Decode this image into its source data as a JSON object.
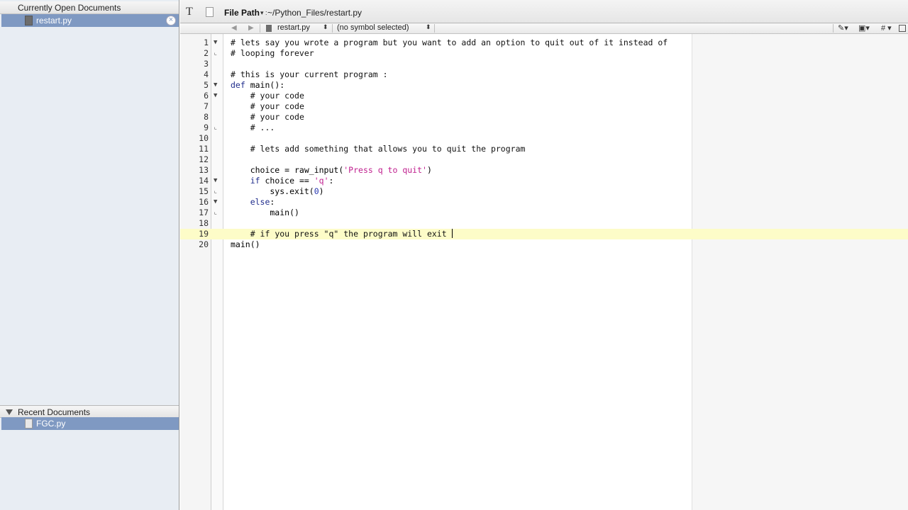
{
  "sidebar": {
    "open_header": "Currently Open Documents",
    "open_documents": [
      {
        "name": "restart.py"
      }
    ],
    "recent_header": "Recent Documents",
    "recent_documents": [
      {
        "name": "FGC.py"
      }
    ],
    "close_glyph": "×"
  },
  "toolbar": {
    "text_icon": "T",
    "path_label": "File Path",
    "path_caret": "▾ :",
    "path_value": "~/Python_Files/restart.py"
  },
  "navbar": {
    "back": "◀",
    "forward": "▶",
    "file": "restart.py",
    "symbol": "(no symbol selected)",
    "stepper": "⬍",
    "pencil": "✎▾",
    "square": "▣▾",
    "hash": "# ▾"
  },
  "editor": {
    "current_line": 19,
    "lines": [
      {
        "n": "1",
        "fold": "▼",
        "code": "# lets say you wrote a program but you want to add an option to quit out of it instead of"
      },
      {
        "n": "2",
        "fold": "⌞",
        "code": "# looping forever"
      },
      {
        "n": "3",
        "fold": "",
        "code": ""
      },
      {
        "n": "4",
        "fold": "",
        "code": "# this is your current program :"
      },
      {
        "n": "5",
        "fold": "▼",
        "code": "def main():"
      },
      {
        "n": "6",
        "fold": "▼",
        "code": "    # your code"
      },
      {
        "n": "7",
        "fold": "",
        "code": "    # your code"
      },
      {
        "n": "8",
        "fold": "",
        "code": "    # your code"
      },
      {
        "n": "9",
        "fold": "⌞",
        "code": "    # ..."
      },
      {
        "n": "10",
        "fold": "",
        "code": ""
      },
      {
        "n": "11",
        "fold": "",
        "code": "    # lets add something that allows you to quit the program"
      },
      {
        "n": "12",
        "fold": "",
        "code": ""
      },
      {
        "n": "13",
        "fold": "",
        "code": "    choice = raw_input('Press q to quit')"
      },
      {
        "n": "14",
        "fold": "▼",
        "code": "    if choice == 'q':"
      },
      {
        "n": "15",
        "fold": "⌞",
        "code": "        sys.exit(0)"
      },
      {
        "n": "16",
        "fold": "▼",
        "code": "    else:"
      },
      {
        "n": "17",
        "fold": "⌞",
        "code": "        main()"
      },
      {
        "n": "18",
        "fold": "",
        "code": ""
      },
      {
        "n": "19",
        "fold": "",
        "code": "    # if you press \"q\" the program will exit "
      },
      {
        "n": "20",
        "fold": "",
        "code": "main()"
      }
    ]
  },
  "colors": {
    "sidebar_bg": "#e8edf3",
    "selection": "#7f99c2",
    "current_line": "#fdfcc8",
    "keyword": "#1f2c8c",
    "string": "#c0208f",
    "number": "#2535b0"
  }
}
